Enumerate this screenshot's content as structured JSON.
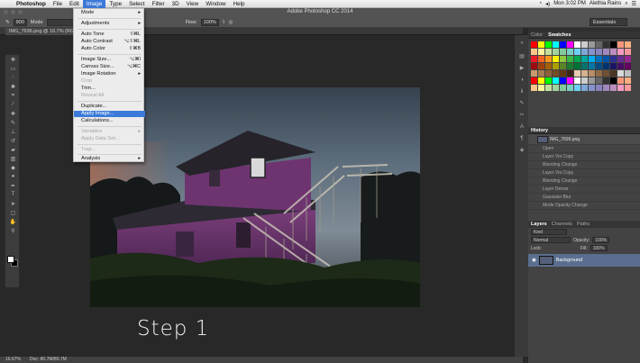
{
  "menubar": {
    "app": "Photoshop",
    "items": [
      "File",
      "Edit",
      "Image",
      "Type",
      "Select",
      "Filter",
      "3D",
      "View",
      "Window",
      "Help"
    ],
    "active": "Image",
    "clock": "Mon 3:02 PM",
    "user": "Alethia Rains"
  },
  "window": {
    "title": "Adobe Photoshop CC 2014"
  },
  "options": {
    "size": "900",
    "mode_label": "Mode",
    "flow_label": "Flow:",
    "flow": "100%",
    "workspace": "Essentials"
  },
  "document": {
    "tab_label": "IMG_7696.png @ 16.7% (RGB/8)"
  },
  "image_menu": {
    "mode": "Mode",
    "adjustments": "Adjustments",
    "auto_tone": "Auto Tone",
    "auto_tone_sc": "⇧⌘L",
    "auto_contrast": "Auto Contrast",
    "auto_contrast_sc": "⌥⇧⌘L",
    "auto_color": "Auto Color",
    "auto_color_sc": "⇧⌘B",
    "image_size": "Image Size...",
    "image_size_sc": "⌥⌘I",
    "canvas_size": "Canvas Size...",
    "canvas_size_sc": "⌥⌘C",
    "image_rotation": "Image Rotation",
    "crop": "Crop",
    "trim": "Trim...",
    "reveal_all": "Reveal All",
    "duplicate": "Duplicate...",
    "apply_image": "Apply Image...",
    "calculations": "Calculations...",
    "variables": "Variables",
    "apply_data_set": "Apply Data Set...",
    "trap": "Trap...",
    "analysis": "Analysis"
  },
  "caption": "Step 1",
  "statusbar": {
    "zoom": "16.67%",
    "doc": "Doc: 80.7M/80.7M"
  },
  "panels": {
    "color_tab": "Color",
    "swatches_tab": "Swatches",
    "history_tab": "History",
    "history_snapshot": "IMG_7696.png",
    "history_items": [
      "Open",
      "Layer Via Copy",
      "Blending Change",
      "Layer Via Copy",
      "Blending Change",
      "Layer Dense",
      "Gaussian Blur",
      "Mode Opacity Change"
    ],
    "layers_tab": "Layers",
    "channels_tab": "Channels",
    "paths_tab": "Paths",
    "kind": "Kind",
    "blend": "Normal",
    "opacity_label": "Opacity:",
    "opacity": "100%",
    "lock_label": "Lock:",
    "fill_label": "Fill:",
    "fill": "100%",
    "layer_name": "Background"
  }
}
